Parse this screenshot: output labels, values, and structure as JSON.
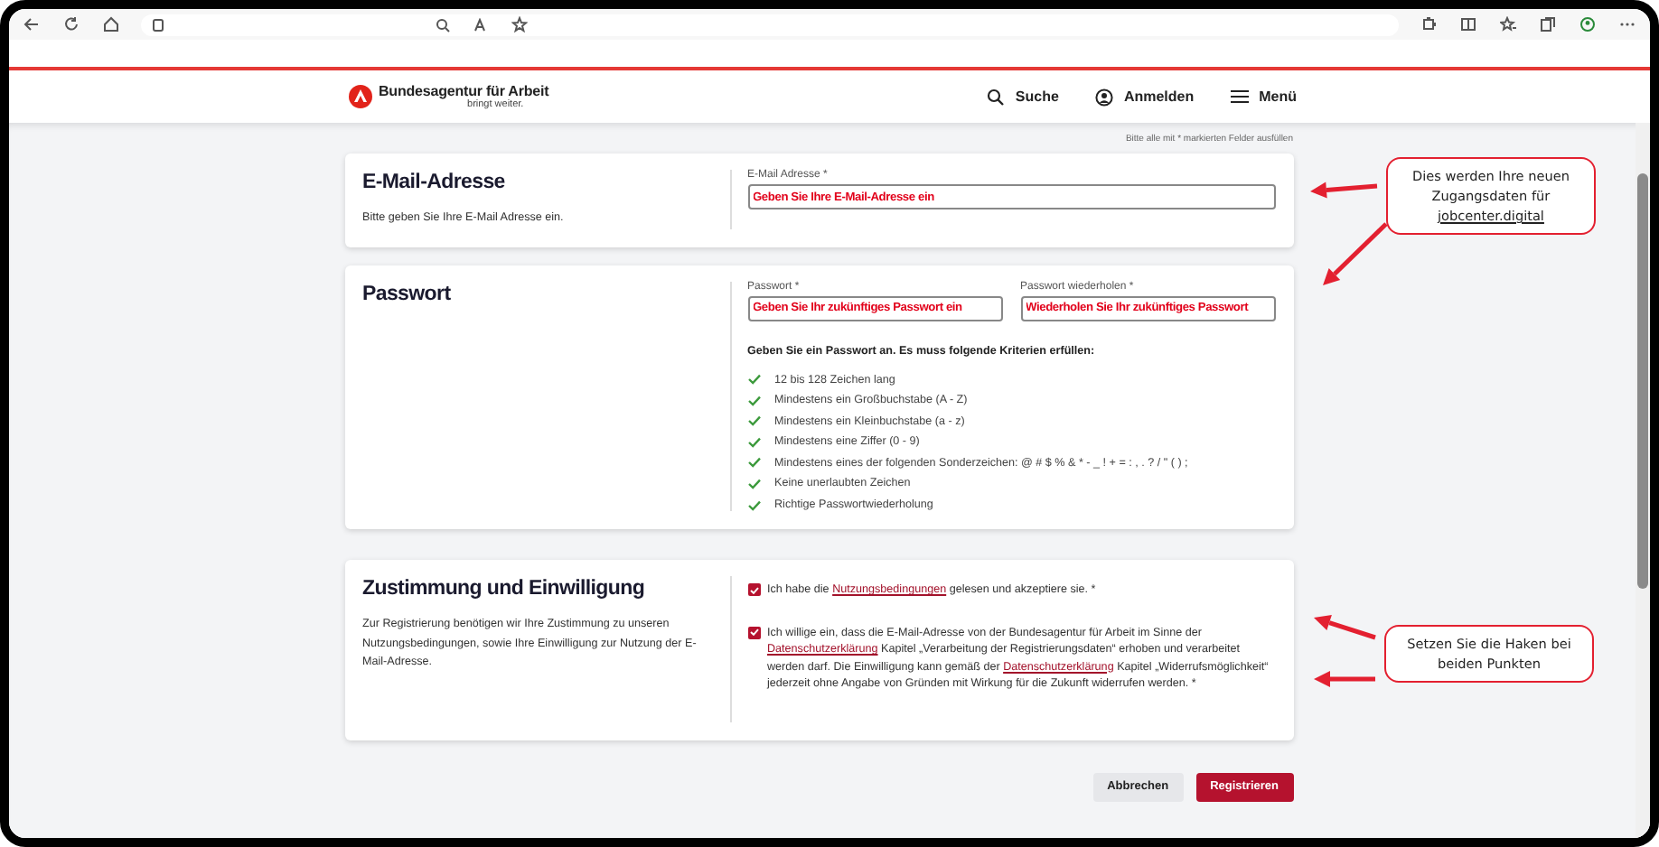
{
  "header": {
    "logo_title": "Bundesagentur für Arbeit",
    "logo_tagline": "bringt weiter.",
    "nav": [
      {
        "label": "Suche",
        "kind": "search"
      },
      {
        "label": "Anmelden",
        "kind": "user"
      },
      {
        "label": "Menü",
        "kind": "menu"
      }
    ]
  },
  "required_note": "Bitte alle mit * markierten Felder ausfüllen",
  "sections": [
    {
      "kind": "email",
      "title": "E-Mail-Adresse",
      "description": "Bitte geben Sie Ihre E-Mail Adresse ein.",
      "fields": [
        {
          "label": "E-Mail Adresse *",
          "placeholder": "Geben Sie Ihre E-Mail-Adresse ein"
        }
      ]
    },
    {
      "kind": "password",
      "title": "Passwort",
      "fields": [
        {
          "label": "Passwort *",
          "placeholder": "Geben Sie Ihr zukünftiges Passwort ein"
        },
        {
          "label": "Passwort wiederholen *",
          "placeholder": "Wiederholen Sie Ihr zukünftiges Passwort"
        }
      ],
      "criteria_title": "Geben Sie ein Passwort an. Es muss folgende Kriterien erfüllen:",
      "criteria": [
        {
          "text": "12 bis 128 Zeichen lang",
          "met": true
        },
        {
          "text": "Mindestens ein Großbuchstabe (A - Z)",
          "met": true
        },
        {
          "text": "Mindestens ein Kleinbuchstabe (a - z)",
          "met": true
        },
        {
          "text": "Mindestens eine Ziffer (0 - 9)",
          "met": true
        },
        {
          "text": "Mindestens eines der folgenden Sonderzeichen: @ # $ % & * - _ ! + = : , . ? / \" ( ) ;",
          "met": true
        },
        {
          "text": "Keine unerlaubten Zeichen",
          "met": true
        },
        {
          "text": "Richtige Passwortwiederholung",
          "met": true
        }
      ]
    },
    {
      "kind": "consent",
      "title": "Zustimmung und Einwilligung",
      "description": "Zur Registrierung benötigen wir Ihre Zustimmung zu unseren Nutzungsbedingungen, sowie Ihre Einwilligung zur Nutzung der E-Mail-Adresse.",
      "consents": [
        {
          "checked": true,
          "parts": [
            {
              "text": "Ich habe die "
            },
            {
              "link": "Nutzungsbedingungen"
            },
            {
              "text": " gelesen und akzeptiere sie. *"
            }
          ]
        },
        {
          "checked": true,
          "parts": [
            {
              "text": "Ich willige ein, dass die E-Mail-Adresse von der Bundesagentur für Arbeit im Sinne der "
            },
            {
              "link": "Datenschutzerklärung"
            },
            {
              "text": " Kapitel „Verarbeitung der Registrierungsdaten“ erhoben und verarbeitet werden darf. Die Einwilligung kann gemäß der "
            },
            {
              "link": "Datenschutzerklärung"
            },
            {
              "text": " Kapitel „Widerrufsmöglichkeit“ jederzeit ohne Angabe von Gründen mit Wirkung für die Zukunft widerrufen werden. *"
            }
          ]
        }
      ]
    }
  ],
  "actions": [
    {
      "label": "Abbrechen",
      "kind": "secondary"
    },
    {
      "label": "Registrieren",
      "kind": "primary"
    }
  ],
  "annotations": [
    {
      "text": "Dies werden Ihre neuen Zugangsdaten für",
      "link": "jobcenter.digital"
    },
    {
      "text": "Setzen Sie die Haken bei beiden Punkten"
    }
  ]
}
